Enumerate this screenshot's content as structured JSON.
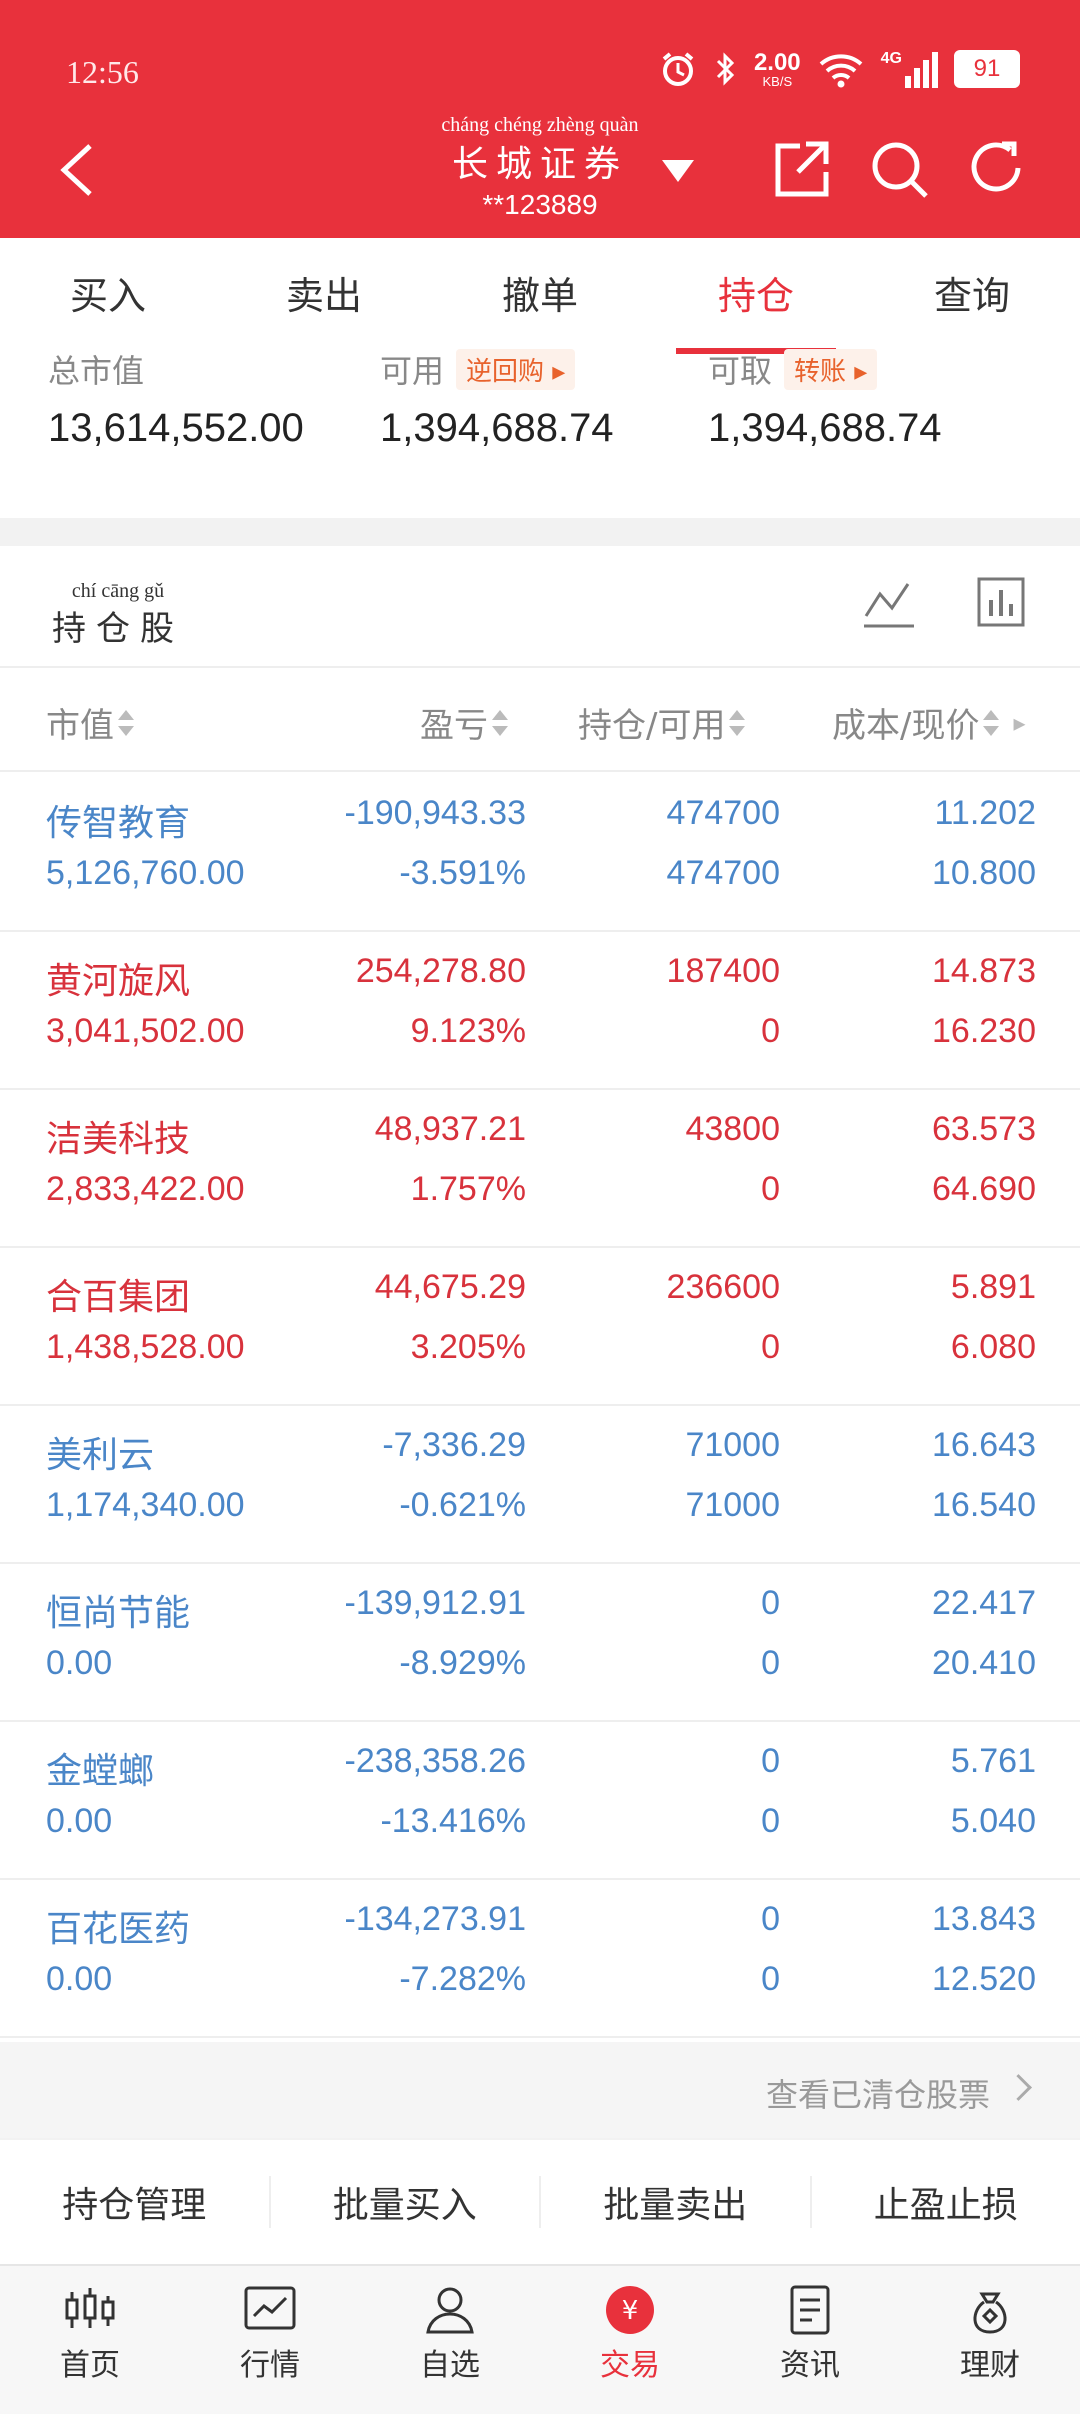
{
  "status_bar": {
    "time": "12:56",
    "network_speed": "2.00",
    "network_unit": "KB/S",
    "signal": "4G",
    "battery": "91"
  },
  "header": {
    "title_pinyin": "cháng chéng zhèng quàn",
    "title": "长城证券",
    "account": "**123889"
  },
  "tabs": [
    "买入",
    "卖出",
    "撤单",
    "持仓",
    "查询"
  ],
  "active_tab": "持仓",
  "summary": {
    "total_label": "总市值",
    "total_value": "13,614,552.00",
    "available_label": "可用",
    "available_tag": "逆回购",
    "available_value": "1,394,688.74",
    "withdrawable_label": "可取",
    "withdrawable_tag": "转账",
    "withdrawable_value": "1,394,688.74"
  },
  "holdings_section": {
    "title_pinyin": "chí cāng gǔ",
    "title": "持仓股"
  },
  "columns": [
    "市值",
    "盈亏",
    "持仓/可用",
    "成本/现价"
  ],
  "rows": [
    {
      "name": "传智教育",
      "market_value": "5,126,760.00",
      "pnl": "-190,943.33",
      "pnl_pct": "-3.591%",
      "position": "474700",
      "available": "474700",
      "cost": "11.202",
      "price": "10.800",
      "trend": "down"
    },
    {
      "name": "黄河旋风",
      "market_value": "3,041,502.00",
      "pnl": "254,278.80",
      "pnl_pct": "9.123%",
      "position": "187400",
      "available": "0",
      "cost": "14.873",
      "price": "16.230",
      "trend": "up"
    },
    {
      "name": "洁美科技",
      "market_value": "2,833,422.00",
      "pnl": "48,937.21",
      "pnl_pct": "1.757%",
      "position": "43800",
      "available": "0",
      "cost": "63.573",
      "price": "64.690",
      "trend": "up"
    },
    {
      "name": "合百集团",
      "market_value": "1,438,528.00",
      "pnl": "44,675.29",
      "pnl_pct": "3.205%",
      "position": "236600",
      "available": "0",
      "cost": "5.891",
      "price": "6.080",
      "trend": "up"
    },
    {
      "name": "美利云",
      "market_value": "1,174,340.00",
      "pnl": "-7,336.29",
      "pnl_pct": "-0.621%",
      "position": "71000",
      "available": "71000",
      "cost": "16.643",
      "price": "16.540",
      "trend": "down"
    },
    {
      "name": "恒尚节能",
      "market_value": "0.00",
      "pnl": "-139,912.91",
      "pnl_pct": "-8.929%",
      "position": "0",
      "available": "0",
      "cost": "22.417",
      "price": "20.410",
      "trend": "down"
    },
    {
      "name": "金螳螂",
      "market_value": "0.00",
      "pnl": "-238,358.26",
      "pnl_pct": "-13.416%",
      "position": "0",
      "available": "0",
      "cost": "5.761",
      "price": "5.040",
      "trend": "down"
    },
    {
      "name": "百花医药",
      "market_value": "0.00",
      "pnl": "-134,273.91",
      "pnl_pct": "-7.282%",
      "position": "0",
      "available": "0",
      "cost": "13.843",
      "price": "12.520",
      "trend": "down"
    }
  ],
  "cleared_link": "查看已清仓股票",
  "actions": [
    "持仓管理",
    "批量买入",
    "批量卖出",
    "止盈止损"
  ],
  "bottom_nav": [
    "首页",
    "行情",
    "自选",
    "交易",
    "资讯",
    "理财"
  ],
  "bottom_nav_active": "交易",
  "colors": {
    "brand_red": "#e8313c",
    "gain": "#d8323c",
    "loss": "#4a86c8"
  }
}
